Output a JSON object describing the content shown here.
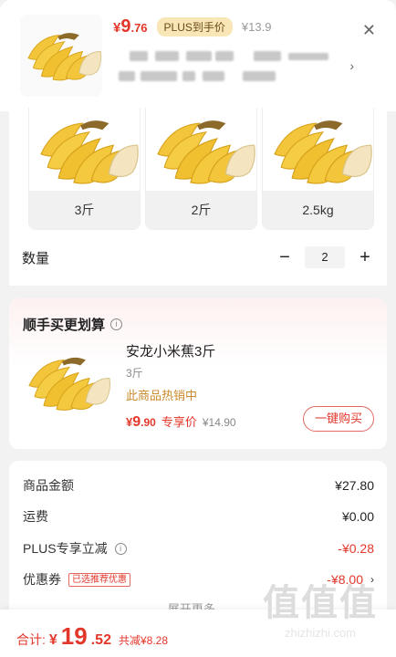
{
  "header": {
    "price_currency": "¥",
    "price_int": "9",
    "price_dec": ".76",
    "plus_badge": "PLUS到手价",
    "original_price": "¥13.9"
  },
  "variants": [
    {
      "label": "3斤"
    },
    {
      "label": "2斤"
    },
    {
      "label": "2.5kg"
    }
  ],
  "quantity": {
    "label": "数量",
    "value": "2",
    "minus": "−",
    "plus": "+"
  },
  "recommend": {
    "title": "顺手买更划算",
    "info_glyph": "i",
    "name": "安龙小米蕉3斤",
    "spec": "3斤",
    "hot": "此商品热销中",
    "price_currency": "¥",
    "price_int": "9",
    "price_dec": ".90",
    "price_tag": "专享价",
    "original_price": "¥14.90",
    "buy_button": "一键购买"
  },
  "summary": {
    "goods_label": "商品金额",
    "goods_amount": "¥27.80",
    "shipping_label": "运费",
    "shipping_amount": "¥0.00",
    "plus_label": "PLUS专享立减",
    "plus_amount": "-¥0.28",
    "coupon_label": "优惠券",
    "coupon_tag": "已选推荐优惠",
    "coupon_amount": "-¥8.00",
    "expand_label": "展开更多"
  },
  "footer": {
    "total_label": "合计:",
    "total_currency": "¥",
    "total_int": "19",
    "total_dec": ".52",
    "saved": "共减¥8.28"
  },
  "watermark": {
    "logo": "值值值",
    "url": "zhizhizhi.com"
  },
  "icons": {
    "close": "close-icon",
    "chevron": "chevron-right-icon",
    "info": "info-icon"
  },
  "colors": {
    "accent": "#e3372b",
    "plus_badge_bg": "#f9e6b7",
    "hot": "#c98a2b"
  }
}
